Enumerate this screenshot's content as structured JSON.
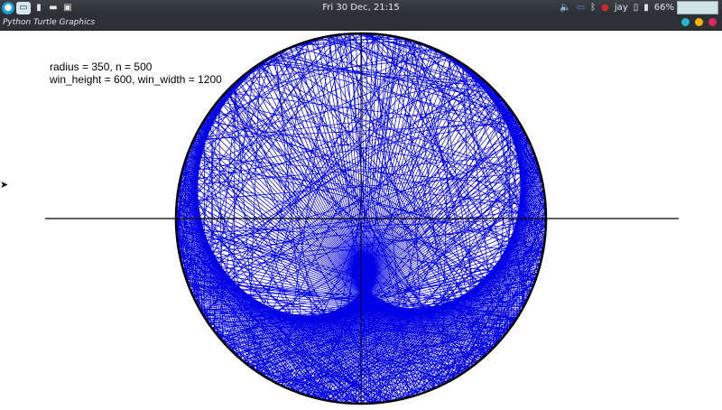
{
  "panel": {
    "clock": "Fri 30 Dec, 21:15",
    "user": "jay",
    "battery": "66%",
    "launchers": [
      "menu-icon",
      "window-icon",
      "terminal-small-icon",
      "folder-icon",
      "terminal-icon"
    ]
  },
  "window": {
    "title": "Python Turtle Graphics",
    "button_colors": [
      "#22b8cf",
      "#f0b400",
      "#e0245e"
    ]
  },
  "info": {
    "line1": "radius = 350, n = 500",
    "line2": "win_height = 600, win_width = 1200"
  },
  "drawing": {
    "radius_label": 350,
    "n": 500,
    "line_color": "#0000e6",
    "circle_color": "#000000"
  }
}
